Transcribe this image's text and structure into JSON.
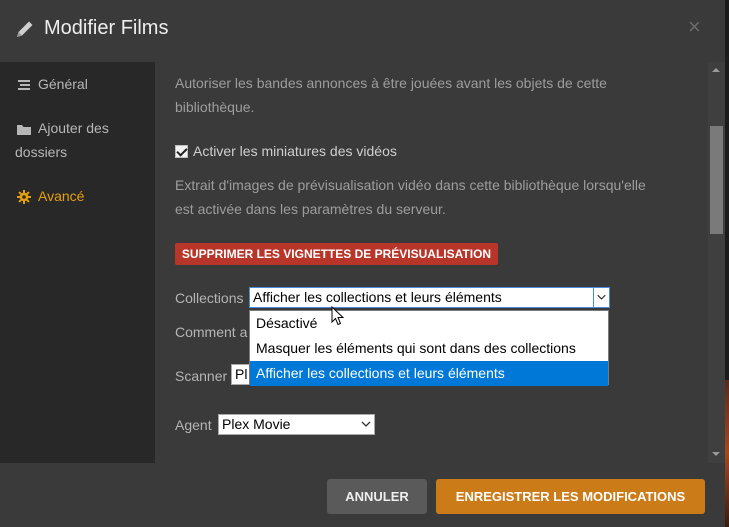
{
  "header": {
    "title": "Modifier Films",
    "close": "×"
  },
  "sidebar": {
    "items": [
      {
        "label": "Général",
        "icon": "list-icon",
        "active": false
      },
      {
        "label_line1": "Ajouter des",
        "label_line2": "dossiers",
        "icon": "folder-icon",
        "active": false
      },
      {
        "label": "Avancé",
        "icon": "gear-icon",
        "active": true
      }
    ]
  },
  "content": {
    "trailers_desc_line1": "Autoriser les bandes annonces à être jouées avant les objets de cette",
    "trailers_desc_line2": "bibliothèque.",
    "thumbnails_checkbox_label": "Activer les miniatures des vidéos",
    "thumbnails_checked": true,
    "thumbnails_desc_line1": "Extrait d'images de prévisualisation vidéo dans cette bibliothèque lorsqu'elle",
    "thumbnails_desc_line2": "est activée dans les paramètres du serveur.",
    "delete_previews_button": "SUPPRIMER LES VIGNETTES DE PRÉVISUALISATION",
    "collections": {
      "label": "Collections",
      "selected": "Afficher les collections et leurs éléments",
      "options": [
        "Désactivé",
        "Masquer les éléments qui sont dans des collections",
        "Afficher les collections et leurs éléments"
      ]
    },
    "hidden_label_partial": "Comment a",
    "scanner": {
      "label": "Scanner",
      "value_partial": "Pl"
    },
    "agent": {
      "label": "Agent",
      "value": "Plex Movie"
    }
  },
  "footer": {
    "cancel_label": "ANNULER",
    "save_label": "ENREGISTRER LES MODIFICATIONS"
  },
  "colors": {
    "accent": "#e5a00d",
    "danger": "#b8352a",
    "save": "#cc7b19",
    "selection": "#0078d7"
  }
}
